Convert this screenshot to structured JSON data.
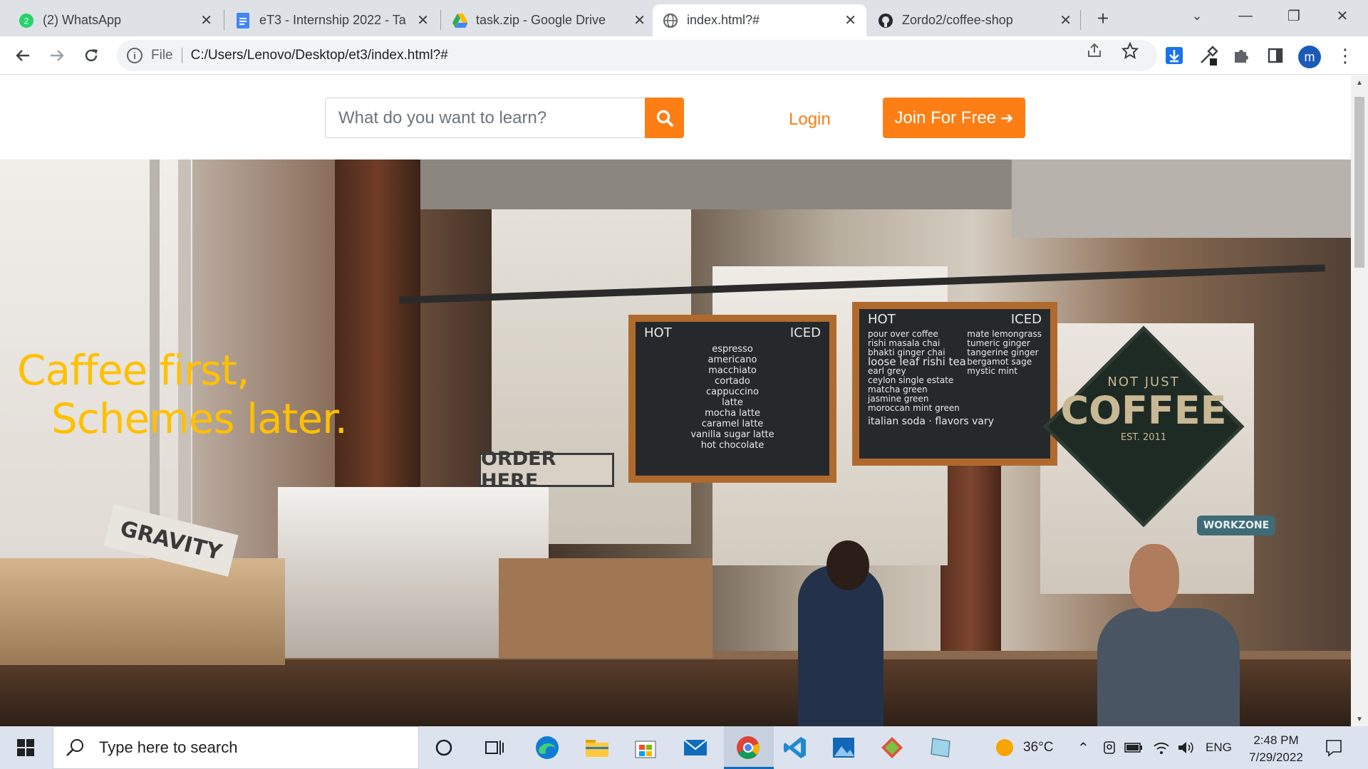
{
  "browser": {
    "tabs": [
      {
        "title": "(2) WhatsApp",
        "badge": "2",
        "icon": "whatsapp-icon"
      },
      {
        "title": "eT3 - Internship 2022 - Ta",
        "icon": "google-docs-icon"
      },
      {
        "title": "task.zip - Google Drive",
        "icon": "google-drive-icon"
      },
      {
        "title": "index.html?#",
        "icon": "globe-icon"
      },
      {
        "title": "Zordo2/coffee-shop",
        "icon": "github-icon"
      }
    ],
    "new_tab": "+",
    "address": {
      "scheme": "File",
      "url": "C:/Users/Lenovo/Desktop/et3/index.html?#"
    },
    "profile_initial": "m"
  },
  "site": {
    "search_placeholder": "What do you want to learn?",
    "login": "Login",
    "join": "Join For Free",
    "join_arrow": "➔",
    "accent_color": "#fd7e14",
    "hero": {
      "line1": "Caffee first,",
      "line2": "Schemes later.",
      "text_color": "#ffc000"
    },
    "photo": {
      "menu_left": {
        "hot": "HOT",
        "iced": "ICED",
        "items": [
          "espresso",
          "americano",
          "macchiato",
          "cortado",
          "cappuccino",
          "latte",
          "mocha latte",
          "caramel latte",
          "vanilla sugar latte",
          "hot chocolate"
        ]
      },
      "menu_right": {
        "hot": "HOT",
        "iced": "ICED",
        "items": [
          "pour over coffee",
          "rishi masala chai",
          "bhakti ginger chai",
          "loose leaf rishi tea",
          "earl grey",
          "ceylon single estate",
          "matcha green",
          "jasmine green",
          "moroccan mint green",
          "mate lemongrass",
          "tumeric ginger",
          "tangerine ginger",
          "bergamot sage",
          "mystic mint",
          "italian soda",
          "flavors vary"
        ]
      },
      "coffee_sign": {
        "top": "NOT JUST",
        "main": "COFFEE",
        "est": "EST. 2011"
      },
      "order_sign": "ORDER HERE",
      "crate_text": "GRAVITY",
      "workzone_sign": "WORKZONE"
    }
  },
  "taskbar": {
    "search_placeholder": "Type here to search",
    "weather": "36°C",
    "language": "ENG",
    "time": "2:48 PM",
    "date": "7/29/2022"
  }
}
